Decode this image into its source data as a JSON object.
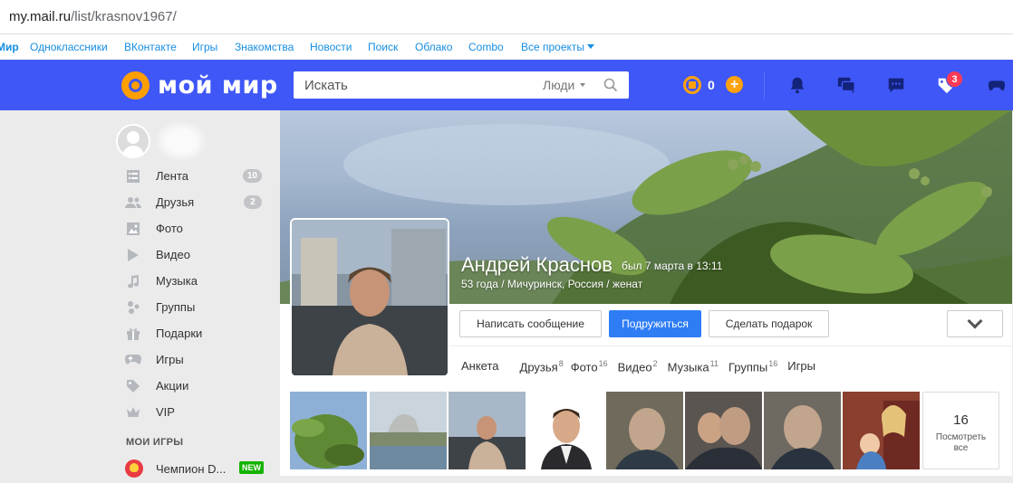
{
  "browser": {
    "url_host": "my.mail.ru",
    "url_path": "/list/krasnov1967/"
  },
  "portal_nav": {
    "items": [
      "Мир",
      "Одноклассники",
      "ВКонтакте",
      "Игры",
      "Знакомства",
      "Новости",
      "Поиск",
      "Облако",
      "Combo",
      "Все проекты"
    ]
  },
  "header": {
    "logo_text": "мой мир",
    "search_placeholder": "Искать",
    "search_scope": "Люди",
    "coins": "0",
    "notifications_badge": "3",
    "accent_color": "#3f57f7",
    "coin_color": "#ffa20d"
  },
  "sidebar": {
    "items": [
      {
        "label": "Лента",
        "icon": "feed-icon",
        "count": "10"
      },
      {
        "label": "Друзья",
        "icon": "friends-icon",
        "count": "2"
      },
      {
        "label": "Фото",
        "icon": "photo-icon",
        "count": ""
      },
      {
        "label": "Видео",
        "icon": "video-icon",
        "count": ""
      },
      {
        "label": "Музыка",
        "icon": "music-icon",
        "count": ""
      },
      {
        "label": "Группы",
        "icon": "groups-icon",
        "count": ""
      },
      {
        "label": "Подарки",
        "icon": "gift-icon",
        "count": ""
      },
      {
        "label": "Игры",
        "icon": "gamepad-icon",
        "count": ""
      },
      {
        "label": "Акции",
        "icon": "tag-icon",
        "count": ""
      },
      {
        "label": "VIP",
        "icon": "crown-icon",
        "count": ""
      }
    ],
    "games_header": "МОИ ИГРЫ",
    "game": {
      "label": "Чемпион D...",
      "badge": "NEW"
    }
  },
  "profile": {
    "name": "Андрей Краснов",
    "last_seen": "был 7 марта в 13:11",
    "details": "53 года / Мичуринск, Россия / женат",
    "buttons": {
      "message": "Написать сообщение",
      "subscribe": "Подружиться",
      "gift": "Сделать подарок"
    },
    "tabs": [
      {
        "label": "Анкета",
        "count": ""
      },
      {
        "label": "Друзья",
        "count": "8"
      },
      {
        "label": "Фото",
        "count": "16"
      },
      {
        "label": "Видео",
        "count": "2"
      },
      {
        "label": "Музыка",
        "count": "11"
      },
      {
        "label": "Группы",
        "count": "16"
      },
      {
        "label": "Игры",
        "count": ""
      }
    ],
    "photos_more": {
      "count": "16",
      "label_1": "Посмотреть",
      "label_2": "все"
    }
  }
}
